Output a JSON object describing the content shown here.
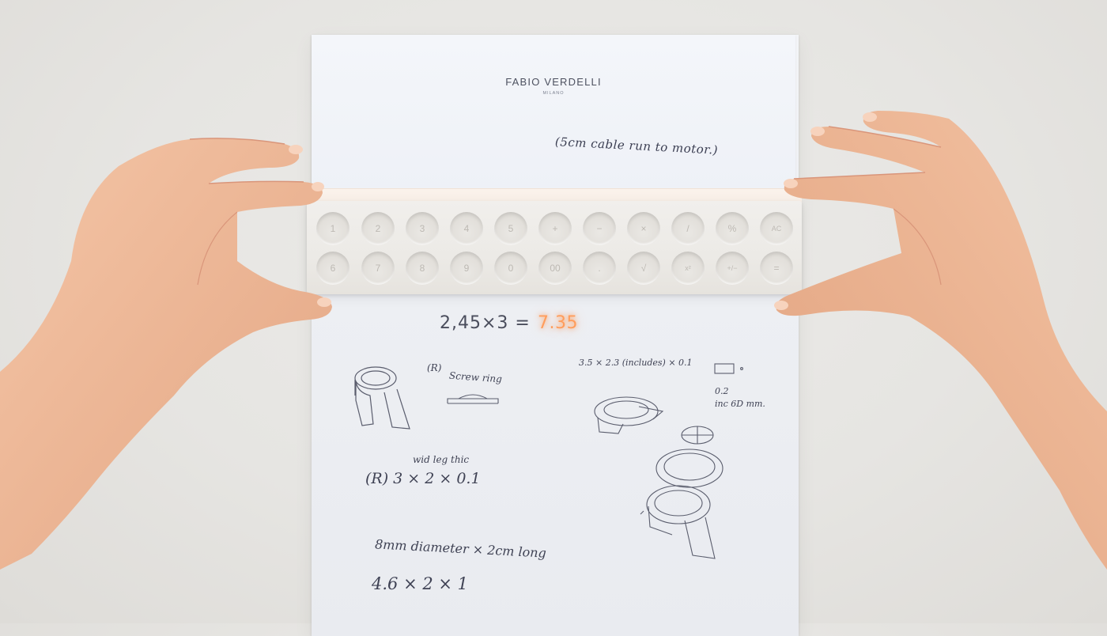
{
  "letterhead": {
    "brand": "FABIO VERDELLI",
    "city": "MILANO",
    "note": "(5cm cable run to motor.)"
  },
  "calculator": {
    "row1": [
      "1",
      "2",
      "3",
      "4",
      "5",
      "+",
      "−",
      "×",
      "/",
      "%",
      "AC"
    ],
    "row2": [
      "6",
      "7",
      "8",
      "9",
      "0",
      "00",
      ".",
      "√",
      "x²",
      "+/−",
      "="
    ],
    "expression": "2,45×3 =",
    "display": "7.35"
  },
  "notes": {
    "r_label": "(R)",
    "screw_ring": "Screw ring",
    "dims_top": "3.5 × 2.3 (includes) × 0.1",
    "inc_note_1": "0.2",
    "inc_note_2": "inc 6D mm.",
    "wid_len_thic": "wid  leg  thic",
    "r_dims": "(R)   3 × 2 × 0.1",
    "diameter_note": "8mm  diameter × 2cm  long",
    "bottom_dims": "4.6  ×  2 × 1"
  },
  "colors": {
    "display_glow": "#ff9d5c",
    "ink": "#3f4254"
  }
}
